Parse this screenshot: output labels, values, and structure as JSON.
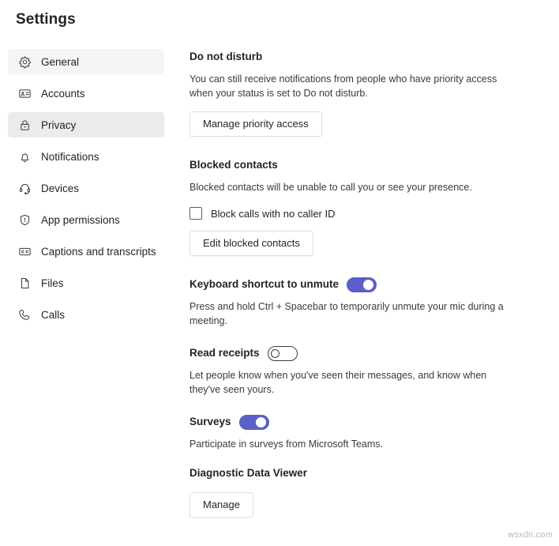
{
  "header": {
    "title": "Settings"
  },
  "sidebar": {
    "items": [
      {
        "label": "General",
        "icon": "gear-icon",
        "state": "hovered"
      },
      {
        "label": "Accounts",
        "icon": "contact-card-icon",
        "state": "normal"
      },
      {
        "label": "Privacy",
        "icon": "lock-icon",
        "state": "selected"
      },
      {
        "label": "Notifications",
        "icon": "bell-icon",
        "state": "normal"
      },
      {
        "label": "Devices",
        "icon": "headset-icon",
        "state": "normal"
      },
      {
        "label": "App permissions",
        "icon": "shield-icon",
        "state": "normal"
      },
      {
        "label": "Captions and transcripts",
        "icon": "closed-caption-icon",
        "state": "normal"
      },
      {
        "label": "Files",
        "icon": "file-icon",
        "state": "normal"
      },
      {
        "label": "Calls",
        "icon": "phone-icon",
        "state": "normal"
      }
    ]
  },
  "main": {
    "do_not_disturb": {
      "title": "Do not disturb",
      "description": "You can still receive notifications from people who have priority access when your status is set to Do not disturb.",
      "button": "Manage priority access"
    },
    "blocked_contacts": {
      "title": "Blocked contacts",
      "description": "Blocked contacts will be unable to call you or see your presence.",
      "checkbox_label": "Block calls with no caller ID",
      "checkbox_checked": "false",
      "button": "Edit blocked contacts"
    },
    "keyboard_shortcut": {
      "title": "Keyboard shortcut to unmute",
      "toggle_state": "on",
      "description": "Press and hold Ctrl + Spacebar to temporarily unmute your mic during a meeting."
    },
    "read_receipts": {
      "title": "Read receipts",
      "toggle_state": "off",
      "description": "Let people know when you've seen their messages, and know when they've seen yours."
    },
    "surveys": {
      "title": "Surveys",
      "toggle_state": "on",
      "description": "Participate in surveys from Microsoft Teams."
    },
    "diagnostic_data_viewer": {
      "title": "Diagnostic Data Viewer",
      "button": "Manage"
    }
  },
  "colors": {
    "accent": "#5b5fc7",
    "selected_row": "#ebebeb",
    "hovered_row": "#f5f5f5"
  },
  "watermark": {
    "text": "wsxdn.com"
  }
}
